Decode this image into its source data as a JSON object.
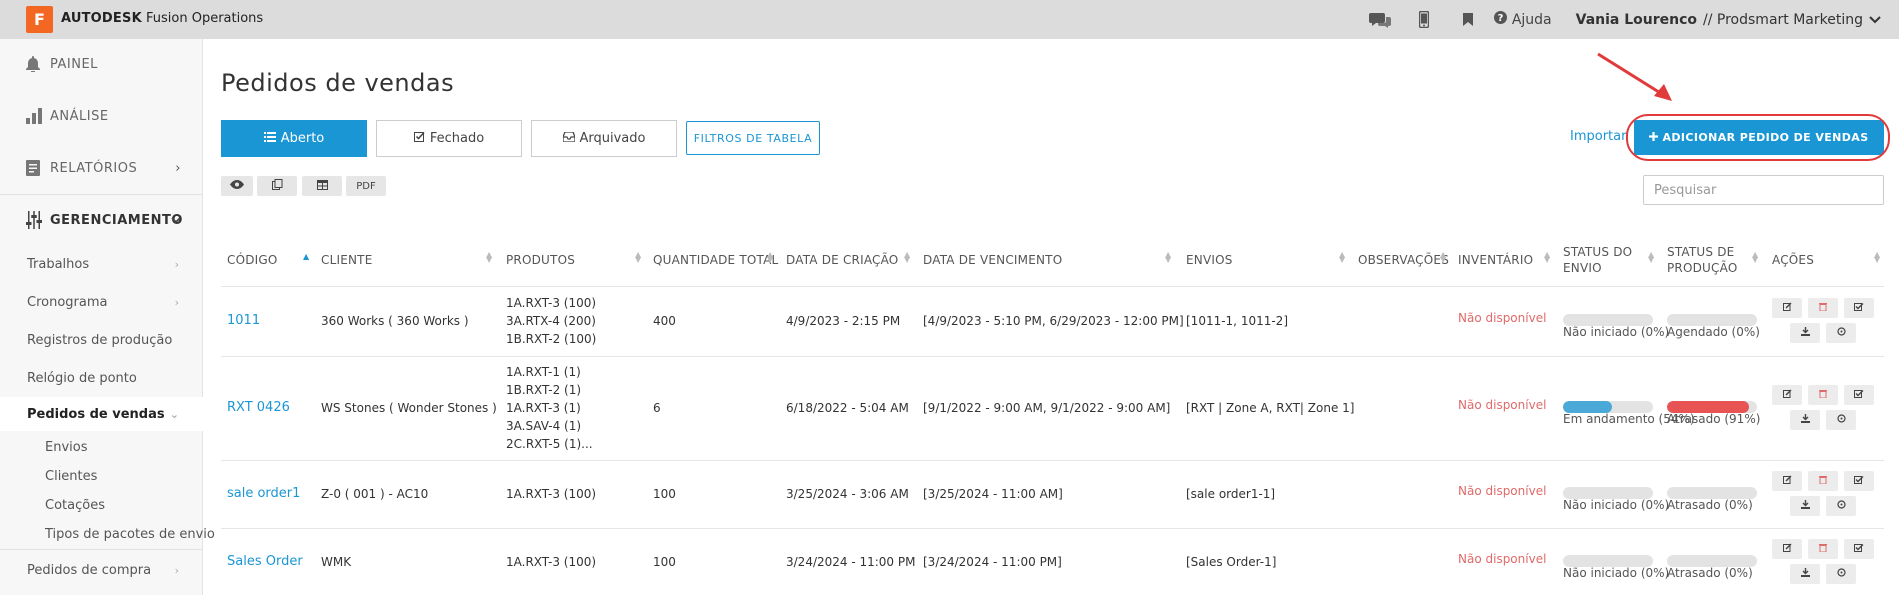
{
  "topbar": {
    "logo_letter": "F",
    "brand_bold": "AUTODESK",
    "brand_rest": " Fusion Operations",
    "help_label": "Ajuda",
    "user_name": "Vania Lourenco",
    "org_name": " // Prodsmart Marketing"
  },
  "sidebar": {
    "painel": "PAINEL",
    "analise": "ANÁLISE",
    "relatorios": "RELATÓRIOS",
    "gerenciamento": "GERENCIAMENTO",
    "trabalhos": "Trabalhos",
    "cronograma": "Cronograma",
    "registros": "Registros de produção",
    "relogio": "Relógio de ponto",
    "pedidos_vendas": "Pedidos de vendas",
    "envios": "Envios",
    "clientes": "Clientes",
    "cotacoes": "Cotações",
    "tipos_pacotes": "Tipos de pacotes de envio",
    "pedidos_compra": "Pedidos de compra"
  },
  "page": {
    "title": "Pedidos de vendas",
    "tab_aberto": "Aberto",
    "tab_fechado": "Fechado",
    "tab_arquivado": "Arquivado",
    "filters": "FILTROS DE TABELA",
    "importar": "Importar",
    "add_button": "ADICIONAR PEDIDO DE VENDAS",
    "pdf": "PDF",
    "search_placeholder": "Pesquisar"
  },
  "table": {
    "headers": {
      "codigo": "CÓDIGO",
      "cliente": "CLIENTE",
      "produtos": "PRODUTOS",
      "quantidade": "QUANTIDADE TOTAL",
      "criacao": "DATA DE CRIAÇÃO",
      "vencimento": "DATA DE VENCIMENTO",
      "envios": "ENVIOS",
      "observacoes": "OBSERVAÇÕES",
      "inventario": "INVENTÁRIO",
      "status_envio_1": "STATUS DO",
      "status_envio_2": "ENVIO",
      "status_prod_1": "STATUS DE",
      "status_prod_2": "PRODUÇÃO",
      "acoes": "AÇÕES"
    },
    "rows": [
      {
        "codigo": "1011",
        "cliente": "360 Works ( 360 Works )",
        "produtos": [
          "1A.RXT-3 (100)",
          "3A.RTX-4 (200)",
          "1B.RXT-2 (100)"
        ],
        "quantidade": "400",
        "criacao": "4/9/2023 - 2:15 PM",
        "vencimento": "[4/9/2023 - 5:10 PM, 6/29/2023 - 12:00 PM]",
        "envios": "[1011-1, 1011-2]",
        "inventario": "Não disponível",
        "status_envio": "Não iniciado (0%)",
        "status_envio_pct": 0,
        "status_prod": "Agendado (0%)",
        "status_prod_pct": 0
      },
      {
        "codigo": "RXT 0426",
        "cliente": "WS Stones ( Wonder Stones )",
        "produtos": [
          "1A.RXT-1 (1)",
          "1B.RXT-2 (1)",
          "1A.RXT-3 (1)",
          "3A.SAV-4 (1)",
          "2C.RXT-5 (1)..."
        ],
        "quantidade": "6",
        "criacao": "6/18/2022 - 5:04 AM",
        "vencimento": "[9/1/2022 - 9:00 AM, 9/1/2022 - 9:00 AM]",
        "envios": "[RXT | Zone A, RXT| Zone 1]",
        "inventario": "Não disponível",
        "status_envio": "Em andamento (54%)",
        "status_envio_pct": 54,
        "status_prod": "Atrasado (91%)",
        "status_prod_pct": 91
      },
      {
        "codigo": "sale order1",
        "cliente": "Z-0 ( 001 ) - AC10",
        "produtos": [
          "1A.RXT-3 (100)"
        ],
        "quantidade": "100",
        "criacao": "3/25/2024 - 3:06 AM",
        "vencimento": "[3/25/2024 - 11:00 AM]",
        "envios": "[sale order1-1]",
        "inventario": "Não disponível",
        "status_envio": "Não iniciado (0%)",
        "status_envio_pct": 0,
        "status_prod": "Atrasado (0%)",
        "status_prod_pct": 0
      },
      {
        "codigo": "Sales Order",
        "cliente": "WMK",
        "produtos": [
          "1A.RXT-3 (100)"
        ],
        "quantidade": "100",
        "criacao": "3/24/2024 - 11:00 PM",
        "vencimento": "[3/24/2024 - 11:00 PM]",
        "envios": "[Sales Order-1]",
        "inventario": "Não disponível",
        "status_envio": "Não iniciado (0%)",
        "status_envio_pct": 0,
        "status_prod": "Atrasado (0%)",
        "status_prod_pct": 0
      }
    ]
  },
  "colors": {
    "accent": "#1a96d4",
    "envio_progress": "#4aa9d6",
    "prod_late": "#e85454",
    "not_available": "#e06a6a",
    "highlight": "#e03a3a"
  },
  "icons": {
    "topbar": [
      "chat-icon",
      "mobile-icon",
      "bookmark-icon",
      "help-icon",
      "chevron-down-icon"
    ],
    "tools": [
      "eye-icon",
      "copy-icon",
      "table-icon"
    ],
    "row_actions": [
      "edit-icon",
      "trash-icon",
      "check-square-icon",
      "download-icon",
      "settings-icon"
    ]
  }
}
